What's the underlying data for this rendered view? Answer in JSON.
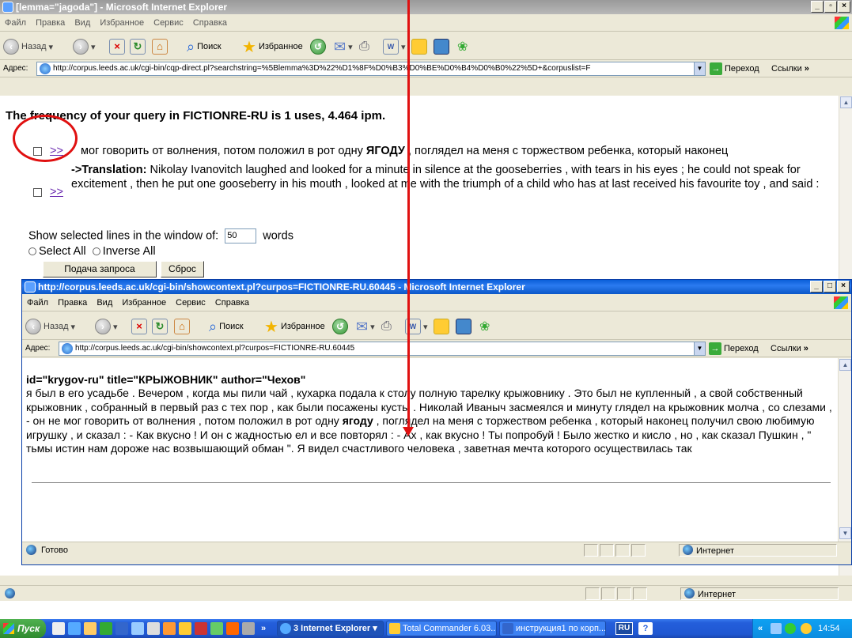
{
  "window1": {
    "title": "[lemma=\"jagoda\"] - Microsoft Internet Explorer",
    "menu": [
      "Файл",
      "Правка",
      "Вид",
      "Избранное",
      "Сервис",
      "Справка"
    ],
    "toolbar": {
      "back": "Назад",
      "search": "Поиск",
      "favorites": "Избранное"
    },
    "address_label": "Адрес:",
    "url": "http://corpus.leeds.ac.uk/cgi-bin/cqp-direct.pl?searchstring=%5Blemma%3D%22%D1%8F%D0%B3%D0%BE%D0%B4%D0%B0%22%5D+&corpuslist=F",
    "go": "Переход",
    "links": "Ссылки",
    "frequency_text": "The frequency of your query in FICTIONRE-RU is 1 uses, 4.464 ipm.",
    "result": {
      "link": ">>",
      "pre": "мог говорить от волнения, потом положил в рот одну",
      "hit": "ЯГОДУ",
      "post": ", поглядел на меня с торжеством ребенка, который наконец",
      "translation_label": "->Translation:",
      "translation": "Nikolay Ivanovitch laughed and looked for a minute in silence at the gooseberries , with tears in his eyes ; he could not speak for excitement , then he put one gooseberry in his mouth , looked at me with the triumph of a child who has at last received his favourite toy , and said :"
    },
    "show_label": "Show selected lines in the window of:",
    "window_size": "50",
    "words": "words",
    "select_all": "Select All",
    "inverse_all": "Inverse All",
    "submit": "Подача запроса",
    "reset": "Сброс"
  },
  "window2": {
    "title": "http://corpus.leeds.ac.uk/cgi-bin/showcontext.pl?curpos=FICTIONRE-RU.60445 - Microsoft Internet Explorer",
    "menu": [
      "Файл",
      "Правка",
      "Вид",
      "Избранное",
      "Сервис",
      "Справка"
    ],
    "url": "http://corpus.leeds.ac.uk/cgi-bin/showcontext.pl?curpos=FICTIONRE-RU.60445",
    "header": "id=\"krygov-ru\" title=\"КРЫЖОВНИК\" author=\"Чехов\"",
    "text_pre": "я был в его усадьбе . Вечером , когда мы пили чай , кухарка подала к столу полную тарелку крыжовнику . Это был не купленный , а свой собственный крыжовник , собранный в первый раз с тех пор , как были посажены кусты . Николай Иваныч засмеялся и минуту глядел на крыжовник молча , со слезами , - он не мог говорить от волнения , потом положил в рот одну",
    "text_hit": "ягоду",
    "text_post": ", поглядел на меня с торжеством ребенка , который наконец получил свою любимую игрушку , и сказал : - Как вкусно ! И он с жадностью ел и все повторял : - Ах , как вкусно ! Ты попробуй ! Было жестко и кисло , но , как сказал Пушкин , \" тьмы истин нам дороже нас возвышающий обман \". Я видел счастливого человека , заветная мечта которого осуществилась так",
    "status": "Готово",
    "zone": "Интернет"
  },
  "status1": {
    "zone": "Интернет"
  },
  "taskbar": {
    "start": "Пуск",
    "tasks": [
      "3 Internet Explorer",
      "Total Commander 6.03...",
      "инструкция1 по корп..."
    ],
    "lang": "RU",
    "clock": "14:54"
  },
  "colors": {
    "annotation_red": "#e01010",
    "xp_blue": "#245edb"
  }
}
